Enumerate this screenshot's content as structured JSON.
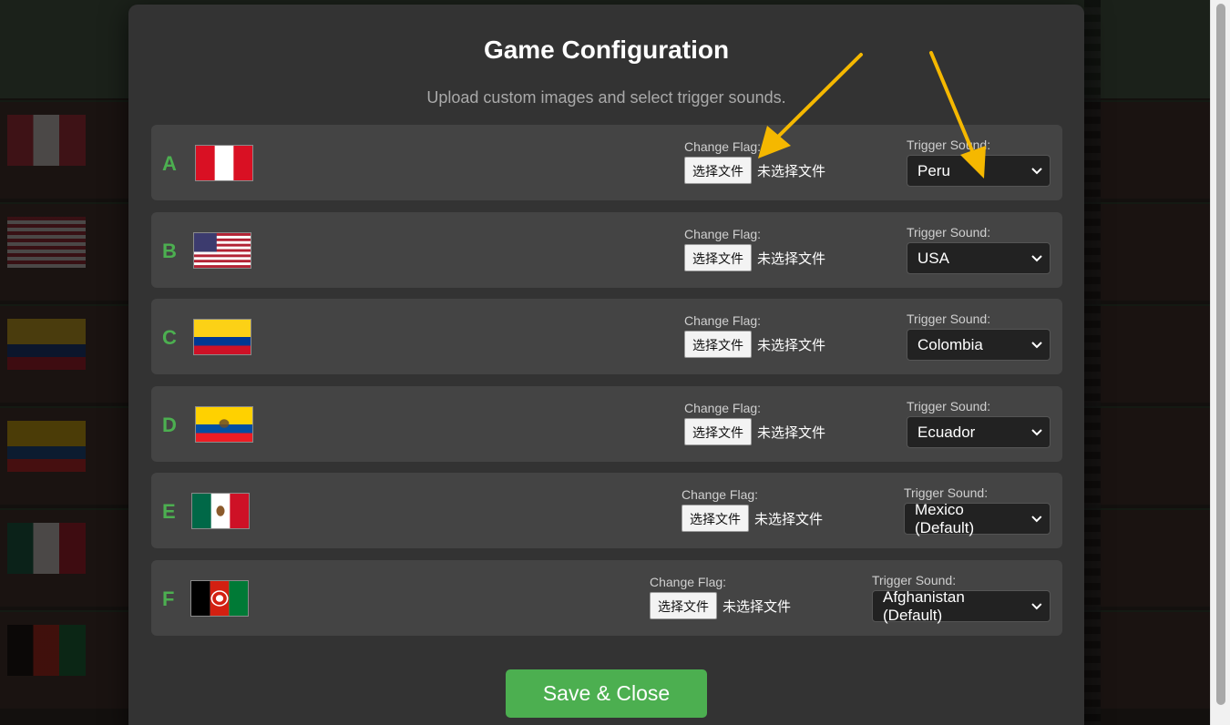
{
  "modal": {
    "title": "Game Configuration",
    "subtitle": "Upload custom images and select trigger sounds.",
    "save_label": "Save & Close"
  },
  "rows": [
    {
      "letter": "A",
      "flag_icon": "peru-flag-icon",
      "flag_label": "Change Flag:",
      "file_button": "选择文件",
      "file_status": "未选择文件",
      "sound_label": "Trigger Sound:",
      "sound_value": "Peru"
    },
    {
      "letter": "B",
      "flag_icon": "usa-flag-icon",
      "flag_label": "Change Flag:",
      "file_button": "选择文件",
      "file_status": "未选择文件",
      "sound_label": "Trigger Sound:",
      "sound_value": "USA"
    },
    {
      "letter": "C",
      "flag_icon": "colombia-flag-icon",
      "flag_label": "Change Flag:",
      "file_button": "选择文件",
      "file_status": "未选择文件",
      "sound_label": "Trigger Sound:",
      "sound_value": "Colombia"
    },
    {
      "letter": "D",
      "flag_icon": "ecuador-flag-icon",
      "flag_label": "Change Flag:",
      "file_button": "选择文件",
      "file_status": "未选择文件",
      "sound_label": "Trigger Sound:",
      "sound_value": "Ecuador"
    },
    {
      "letter": "E",
      "flag_icon": "mexico-flag-icon",
      "flag_label": "Change Flag:",
      "file_button": "选择文件",
      "file_status": "未选择文件",
      "sound_label": "Trigger Sound:",
      "sound_value": "Mexico (Default)"
    },
    {
      "letter": "F",
      "flag_icon": "afghanistan-flag-icon",
      "flag_label": "Change Flag:",
      "file_button": "选择文件",
      "file_status": "未选择文件",
      "sound_label": "Trigger Sound:",
      "sound_value": "Afghanistan (Default)"
    }
  ],
  "colors": {
    "accent": "#4caf50",
    "modal_bg": "#333333",
    "row_bg": "#444444",
    "select_bg": "#222222",
    "annotation_arrow": "#f5b800"
  }
}
